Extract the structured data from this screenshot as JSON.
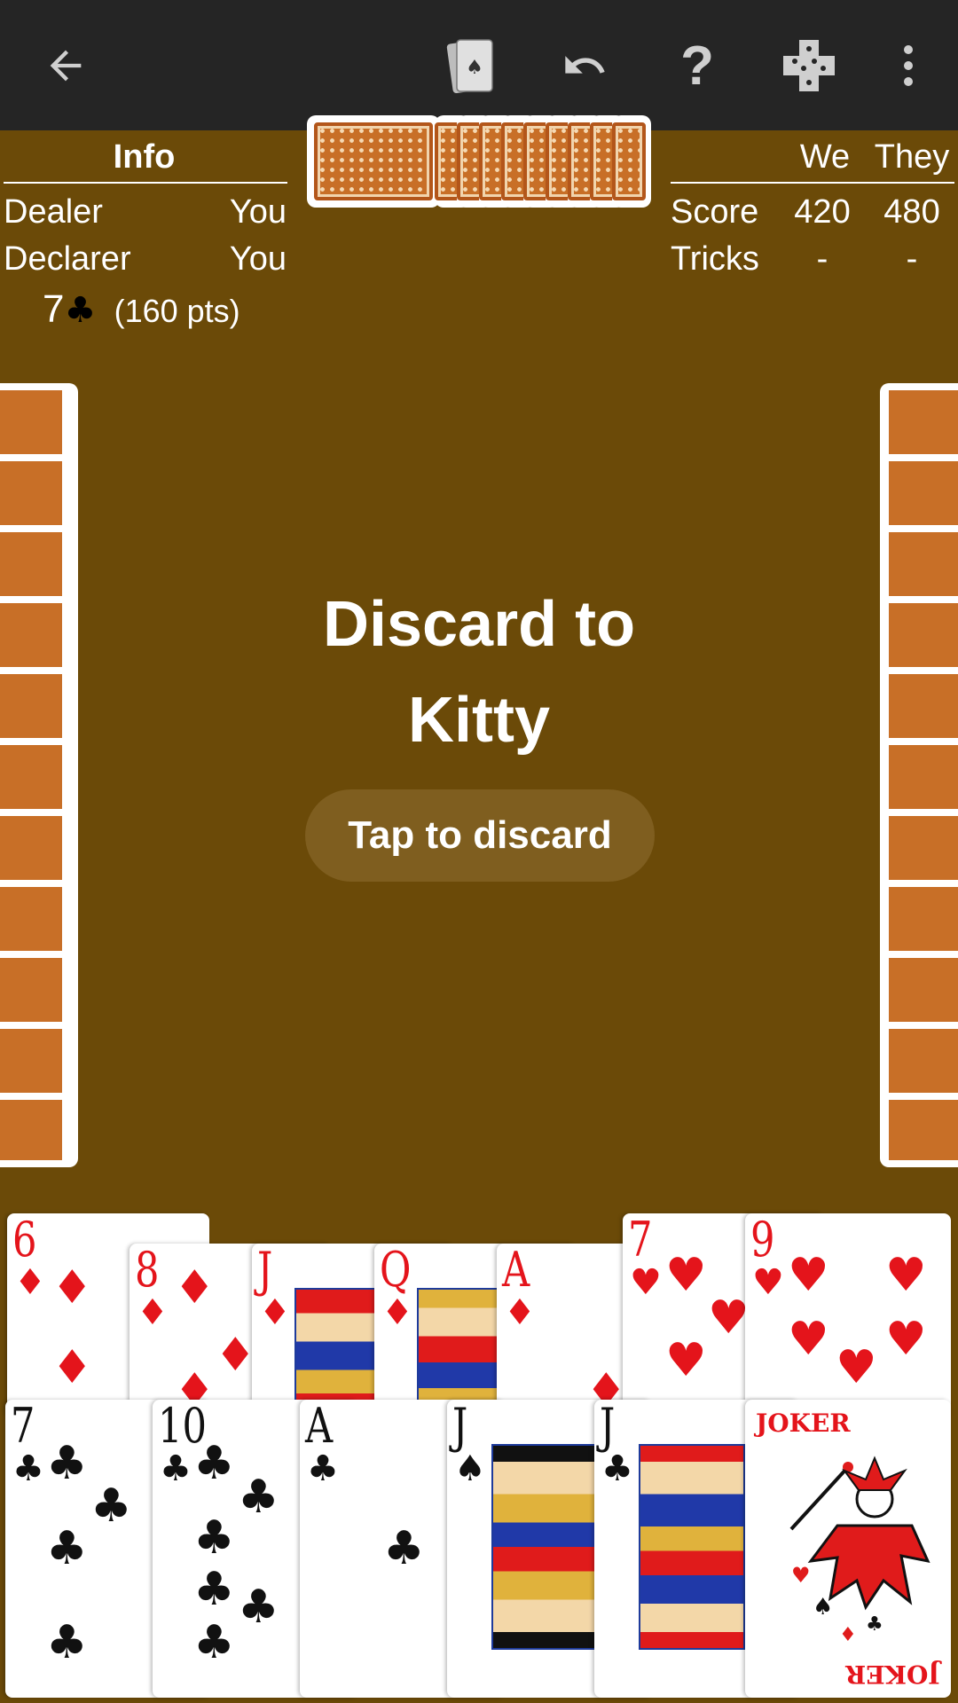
{
  "toolbar": {
    "back_icon": "arrow-left-icon",
    "deck_icon": "playing-cards-icon",
    "undo_icon": "undo-icon",
    "help_label": "?",
    "puzzle_icon": "puzzle-piece-icon",
    "more_icon": "more-vertical-icon"
  },
  "info_panel": {
    "title": "Info",
    "dealer_label": "Dealer",
    "dealer_value": "You",
    "declarer_label": "Declarer",
    "declarer_value": "You",
    "bid_rank": "7",
    "bid_suit": "♣",
    "bid_points": "(160 pts)"
  },
  "score_panel": {
    "col_we": "We",
    "col_they": "They",
    "score_label": "Score",
    "score_we": "420",
    "score_they": "480",
    "tricks_label": "Tricks",
    "tricks_we": "-",
    "tricks_they": "-"
  },
  "center": {
    "message": "Discard to Kitty",
    "action_button": "Tap to discard"
  },
  "hand_top_row": [
    {
      "rank": "6",
      "suit": "♦",
      "color": "#e4141b"
    },
    {
      "rank": "8",
      "suit": "♦",
      "color": "#e4141b"
    },
    {
      "rank": "J",
      "suit": "♦",
      "color": "#e4141b"
    },
    {
      "rank": "Q",
      "suit": "♦",
      "color": "#e4141b"
    },
    {
      "rank": "A",
      "suit": "♦",
      "color": "#e4141b"
    },
    {
      "rank": "7",
      "suit": "♥",
      "color": "#e4141b"
    },
    {
      "rank": "9",
      "suit": "♥",
      "color": "#e4141b"
    }
  ],
  "hand_bottom_row": [
    {
      "rank": "7",
      "suit": "♣",
      "color": "#111111"
    },
    {
      "rank": "10",
      "suit": "♣",
      "color": "#111111"
    },
    {
      "rank": "A",
      "suit": "♣",
      "color": "#111111"
    },
    {
      "rank": "J",
      "suit": "♠",
      "color": "#111111"
    },
    {
      "rank": "J",
      "suit": "♣",
      "color": "#111111"
    },
    {
      "rank": "JOKER",
      "suit": "",
      "color": "#e4141b"
    }
  ],
  "colors": {
    "table": "#6b4a08",
    "toolbar": "#252525",
    "card_back": "#c86f27",
    "button": "#7f5e1f"
  }
}
